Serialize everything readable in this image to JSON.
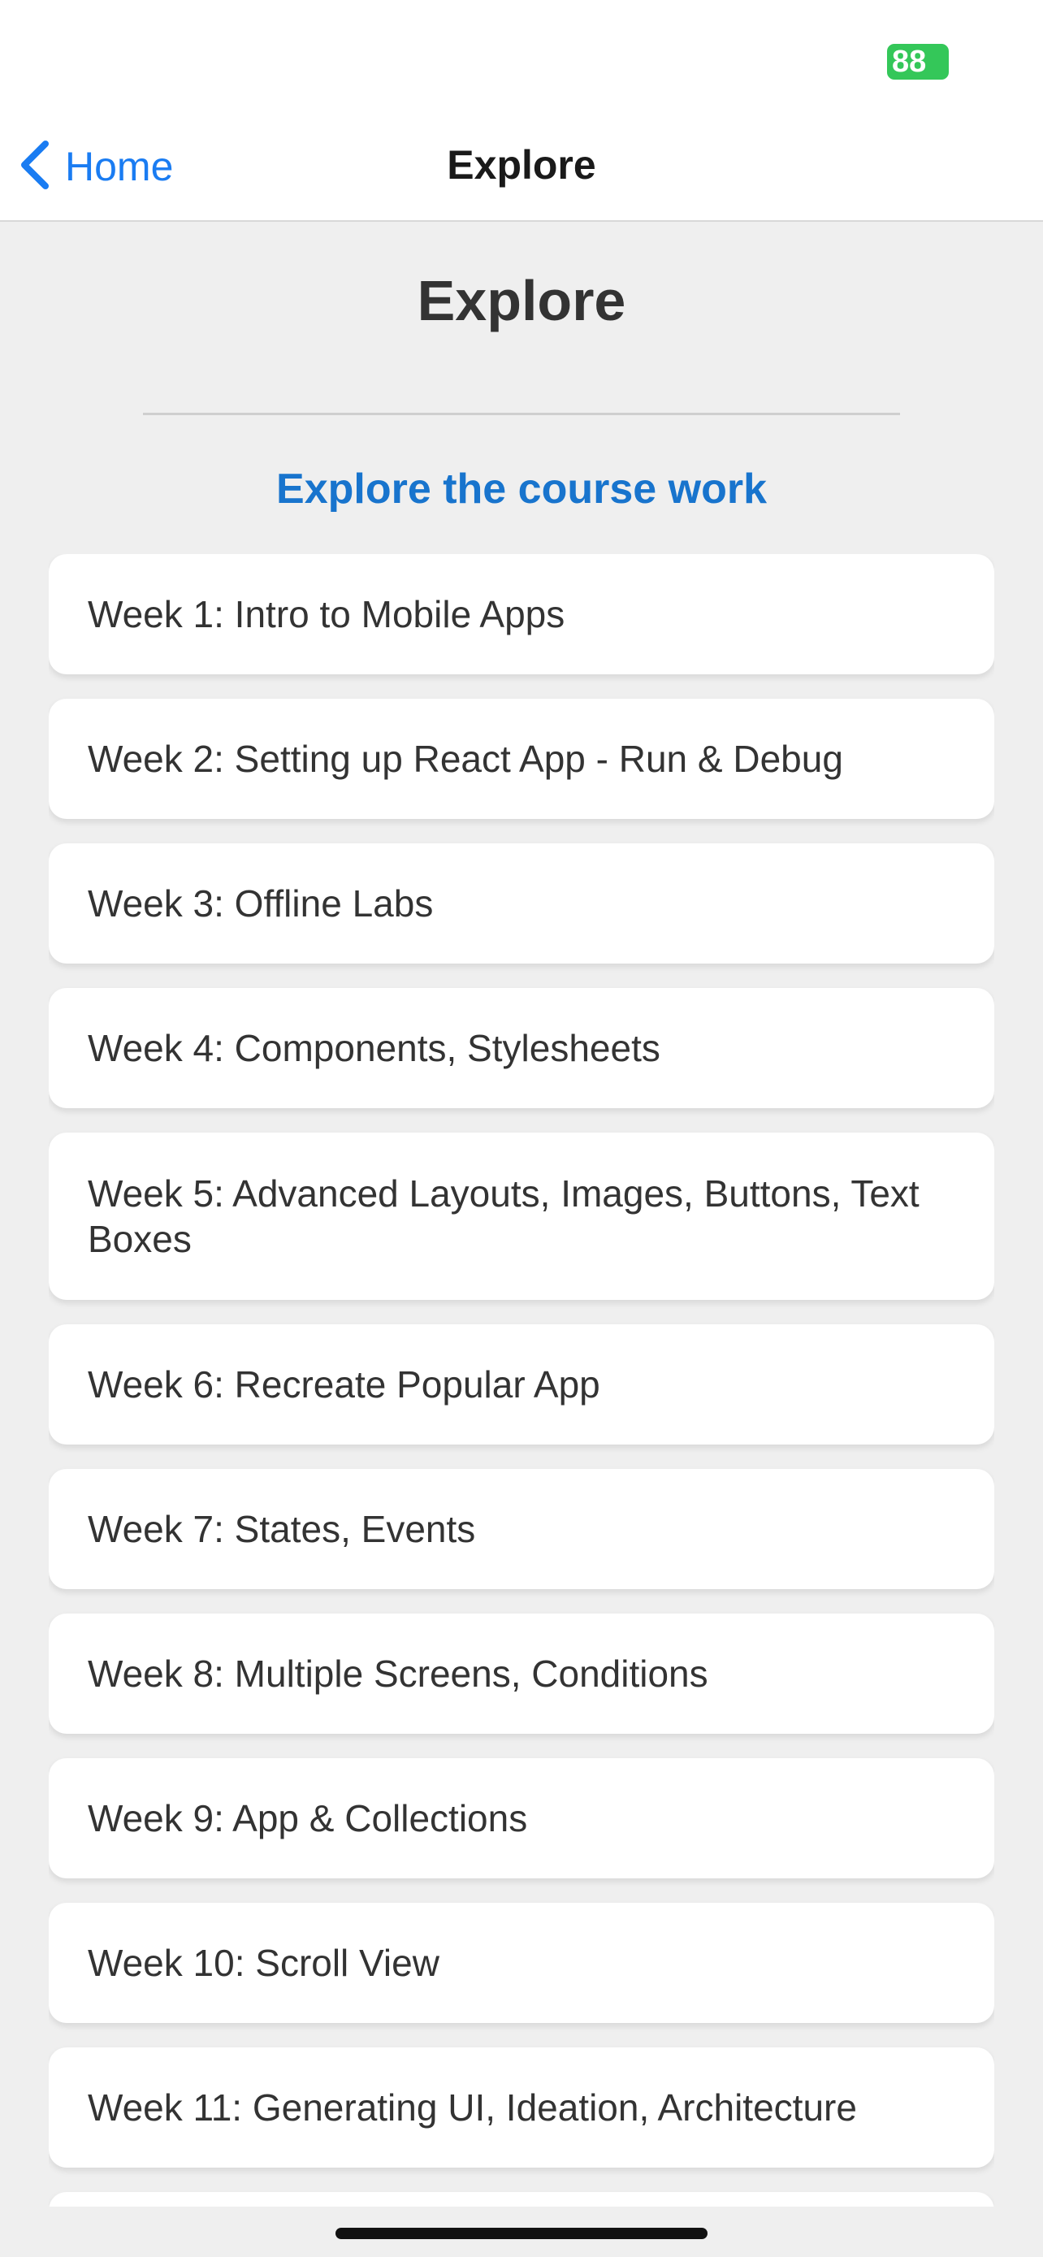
{
  "status_bar": {
    "battery": "88"
  },
  "nav": {
    "back_label": "Home",
    "title": "Explore"
  },
  "page": {
    "title": "Explore",
    "subtitle": "Explore the course work"
  },
  "weeks": [
    "Week 1: Intro to Mobile Apps",
    "Week 2: Setting up React App - Run & Debug",
    "Week 3: Offline Labs",
    "Week 4: Components, Stylesheets",
    "Week 5: Advanced Layouts, Images, Buttons, Text Boxes",
    "Week 6: Recreate Popular App",
    "Week 7: States, Events",
    "Week 8: Multiple Screens, Conditions",
    "Week 9: App & Collections",
    "Week 10: Scroll View",
    "Week 11: Generating UI, Ideation, Architecture",
    ""
  ],
  "colors": {
    "accent": "#1a7cf2",
    "subtitle": "#1874cd",
    "battery": "#34c759",
    "background": "#efefef"
  }
}
